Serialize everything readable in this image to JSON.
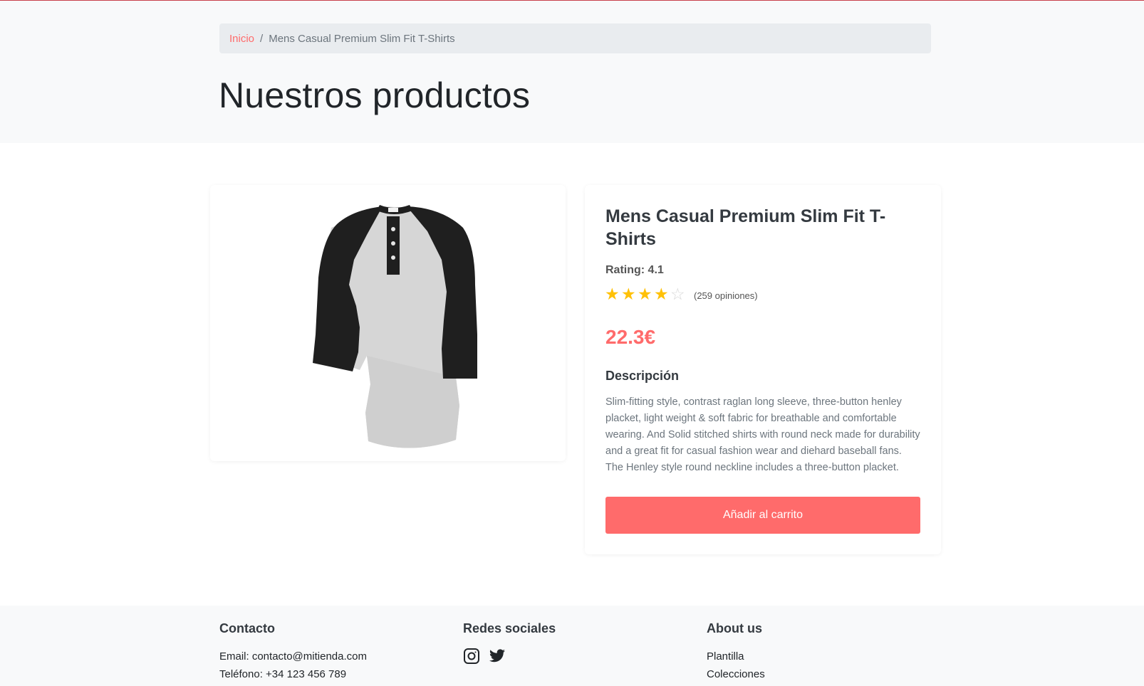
{
  "breadcrumb": {
    "home": "Inicio",
    "separator": "/",
    "current": "Mens Casual Premium Slim Fit T-Shirts"
  },
  "page": {
    "title": "Nuestros productos"
  },
  "product": {
    "title": "Mens Casual Premium Slim Fit T-Shirts",
    "rating_label": "Rating: 4.1",
    "rating_value": 4.1,
    "stars_filled": 4,
    "stars_total": 5,
    "reviews": "(259 opiniones)",
    "price": "22.3€",
    "description_heading": "Descripción",
    "description": "Slim-fitting style, contrast raglan long sleeve, three-button henley placket, light weight & soft fabric for breathable and comfortable wearing. And Solid stitched shirts with round neck made for durability and a great fit for casual fashion wear and diehard baseball fans. The Henley style round neckline includes a three-button placket.",
    "add_to_cart": "Añadir al carrito",
    "image_icon": "raglan-henley-shirt-image"
  },
  "footer": {
    "contact": {
      "heading": "Contacto",
      "email": "Email: contacto@mitienda.com",
      "phone": "Teléfono: +34 123 456 789"
    },
    "social": {
      "heading": "Redes sociales",
      "icons": [
        "instagram-icon",
        "twitter-icon"
      ]
    },
    "about": {
      "heading": "About us",
      "links": [
        "Plantilla",
        "Colecciones"
      ]
    }
  },
  "colors": {
    "accent": "#ff6b6b",
    "star": "#ffc107",
    "top_line": "#c8404a"
  }
}
